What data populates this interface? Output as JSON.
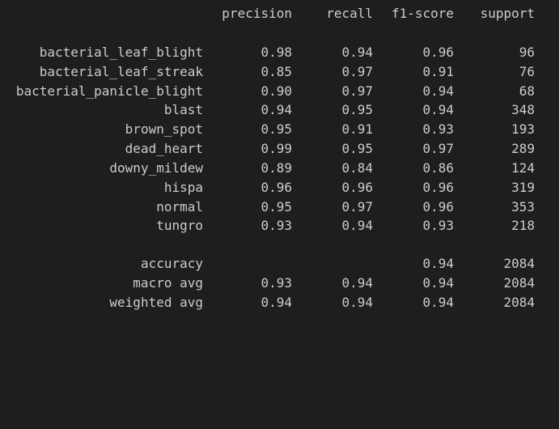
{
  "header": {
    "precision": "precision",
    "recall": "recall",
    "f1": "f1-score",
    "support": "support"
  },
  "classes": [
    {
      "label": "bacterial_leaf_blight",
      "precision": "0.98",
      "recall": "0.94",
      "f1": "0.96",
      "support": "96"
    },
    {
      "label": "bacterial_leaf_streak",
      "precision": "0.85",
      "recall": "0.97",
      "f1": "0.91",
      "support": "76"
    },
    {
      "label": "bacterial_panicle_blight",
      "precision": "0.90",
      "recall": "0.97",
      "f1": "0.94",
      "support": "68"
    },
    {
      "label": "blast",
      "precision": "0.94",
      "recall": "0.95",
      "f1": "0.94",
      "support": "348"
    },
    {
      "label": "brown_spot",
      "precision": "0.95",
      "recall": "0.91",
      "f1": "0.93",
      "support": "193"
    },
    {
      "label": "dead_heart",
      "precision": "0.99",
      "recall": "0.95",
      "f1": "0.97",
      "support": "289"
    },
    {
      "label": "downy_mildew",
      "precision": "0.89",
      "recall": "0.84",
      "f1": "0.86",
      "support": "124"
    },
    {
      "label": "hispa",
      "precision": "0.96",
      "recall": "0.96",
      "f1": "0.96",
      "support": "319"
    },
    {
      "label": "normal",
      "precision": "0.95",
      "recall": "0.97",
      "f1": "0.96",
      "support": "353"
    },
    {
      "label": "tungro",
      "precision": "0.93",
      "recall": "0.94",
      "f1": "0.93",
      "support": "218"
    }
  ],
  "summary": {
    "accuracy": {
      "label": "accuracy",
      "f1": "0.94",
      "support": "2084"
    },
    "macro_avg": {
      "label": "macro avg",
      "precision": "0.93",
      "recall": "0.94",
      "f1": "0.94",
      "support": "2084"
    },
    "weighted_avg": {
      "label": "weighted avg",
      "precision": "0.94",
      "recall": "0.94",
      "f1": "0.94",
      "support": "2084"
    }
  },
  "colors": {
    "background": "#1e1e1e",
    "text": "#cccccc"
  }
}
